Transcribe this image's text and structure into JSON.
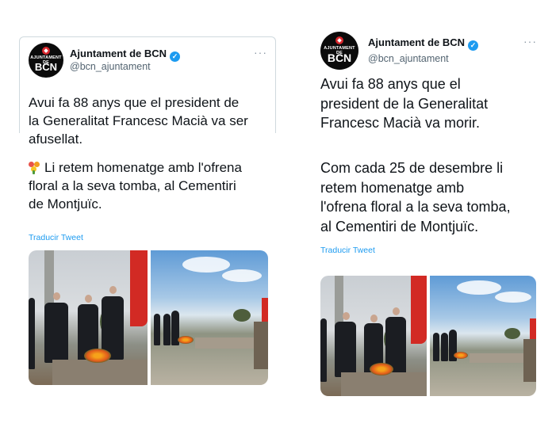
{
  "left_tweet": {
    "avatar": {
      "small_text": "AJUNTAMENT DE",
      "big_text": "BCN"
    },
    "author": "Ajuntament de BCN",
    "handle": "@bcn_ajuntament",
    "more": "···",
    "lines": [
      "Avui fa 88 anys que el president de",
      "la Generalitat Francesc Macià va ser",
      "afusellat."
    ],
    "lines2": [
      "Li retem homenatge amb l'ofrena",
      "floral a la seva tomba, al Cementiri",
      "de Montjuïc."
    ],
    "translate": "Traducir Tweet"
  },
  "right_tweet": {
    "avatar": {
      "small_text": "AJUNTAMENT DE",
      "big_text": "BCN"
    },
    "author": "Ajuntament de BCN",
    "handle": "@bcn_ajuntament",
    "more": "···",
    "lines": [
      "Avui fa 88 anys que el",
      "president de la Generalitat",
      "Francesc Macià va morir."
    ],
    "lines2": [
      "Com cada 25 de desembre li",
      "retem homenatge amb",
      "l'ofrena floral a la seva tomba,",
      "al Cementiri de Montjuïc."
    ],
    "translate": "Traducir Tweet"
  },
  "colors": {
    "link": "#1d9bf0",
    "verified": "#1d9bf0",
    "text": "#0f1419",
    "secondary": "#536471"
  }
}
